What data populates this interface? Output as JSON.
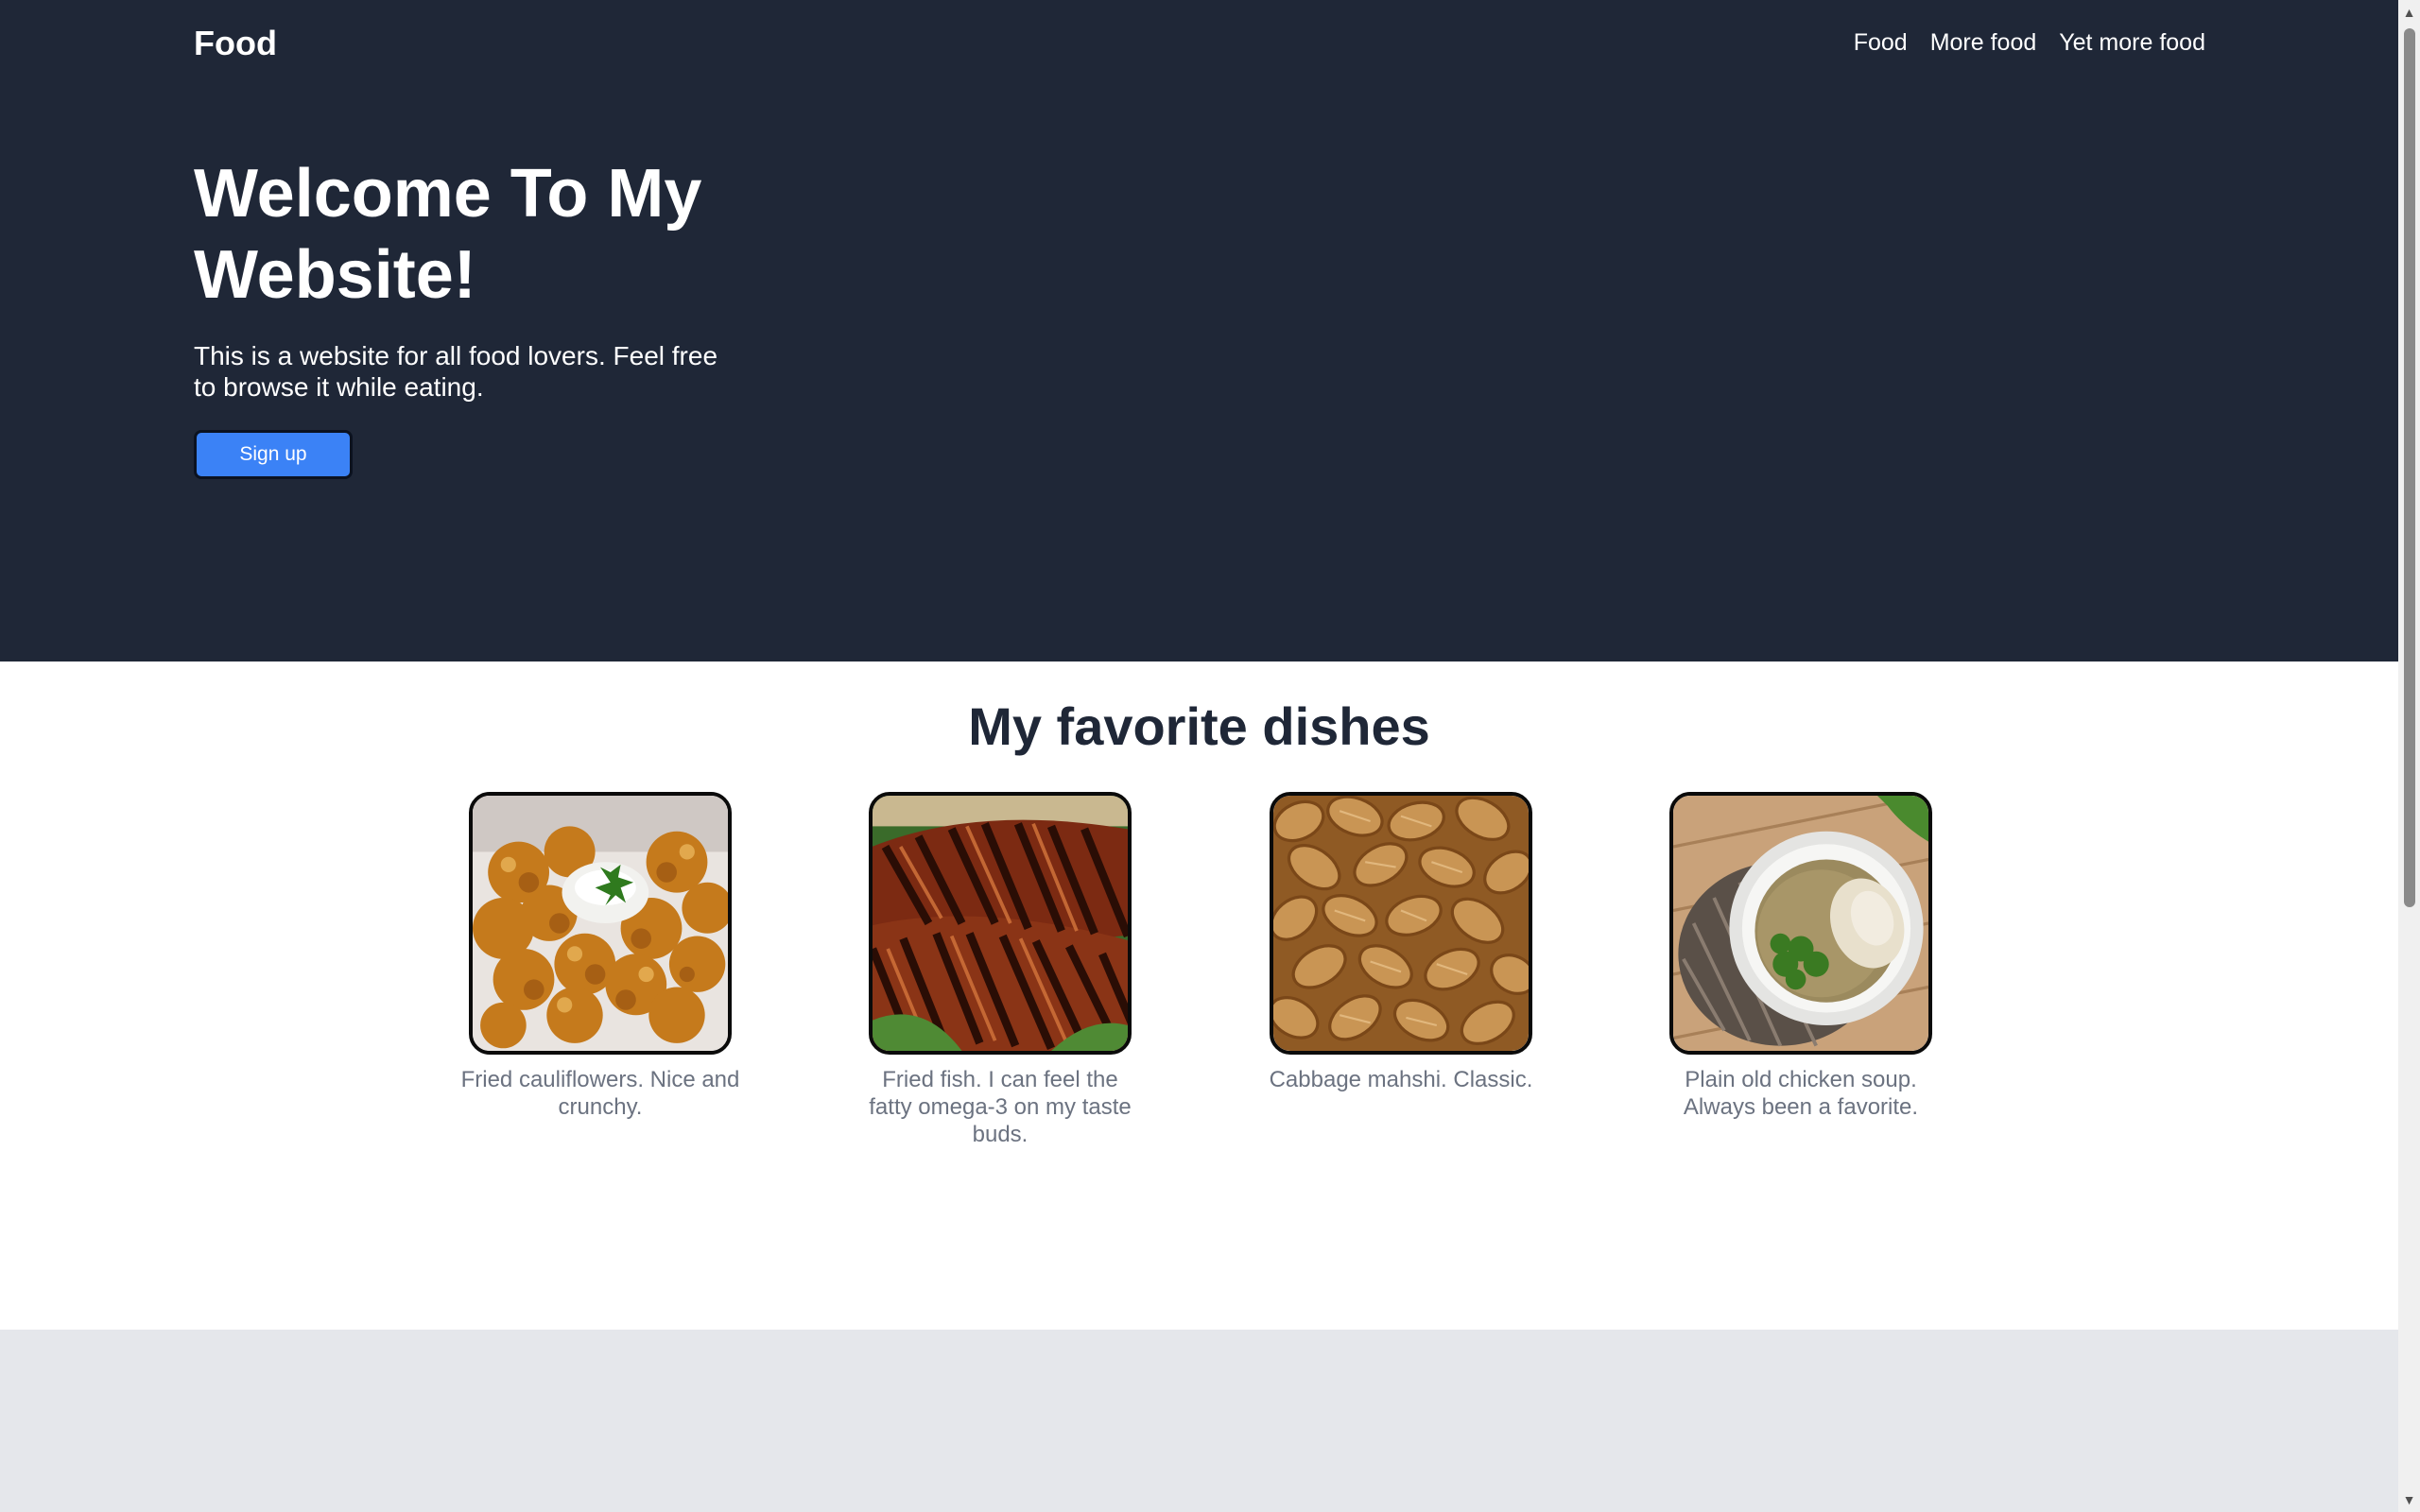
{
  "header": {
    "brand": "Food",
    "nav": [
      "Food",
      "More food",
      "Yet more food"
    ]
  },
  "hero": {
    "title": "Welcome To My Website!",
    "subtitle": "This is a website for all food lovers. Feel free to browse it while eating.",
    "signup_label": "Sign up"
  },
  "favorites": {
    "title": "My favorite dishes",
    "dishes": [
      {
        "caption": "Fried cauliflowers. Nice and crunchy.",
        "image": "fried-cauliflower-photo"
      },
      {
        "caption": "Fried fish. I can feel the fatty omega-3 on my taste buds.",
        "image": "fried-fish-photo"
      },
      {
        "caption": "Cabbage mahshi. Classic.",
        "image": "cabbage-mahshi-photo"
      },
      {
        "caption": "Plain old chicken soup. Always been a favorite.",
        "image": "chicken-soup-photo"
      }
    ]
  },
  "colors": {
    "hero_background": "#1f2737",
    "button_blue": "#3b82f6",
    "page_white": "#ffffff",
    "footer_gray": "#e5e7eb",
    "caption_gray": "#6b7280"
  },
  "scrollbar": {
    "up_icon": "arrow-up-icon",
    "down_icon": "arrow-down-icon"
  }
}
